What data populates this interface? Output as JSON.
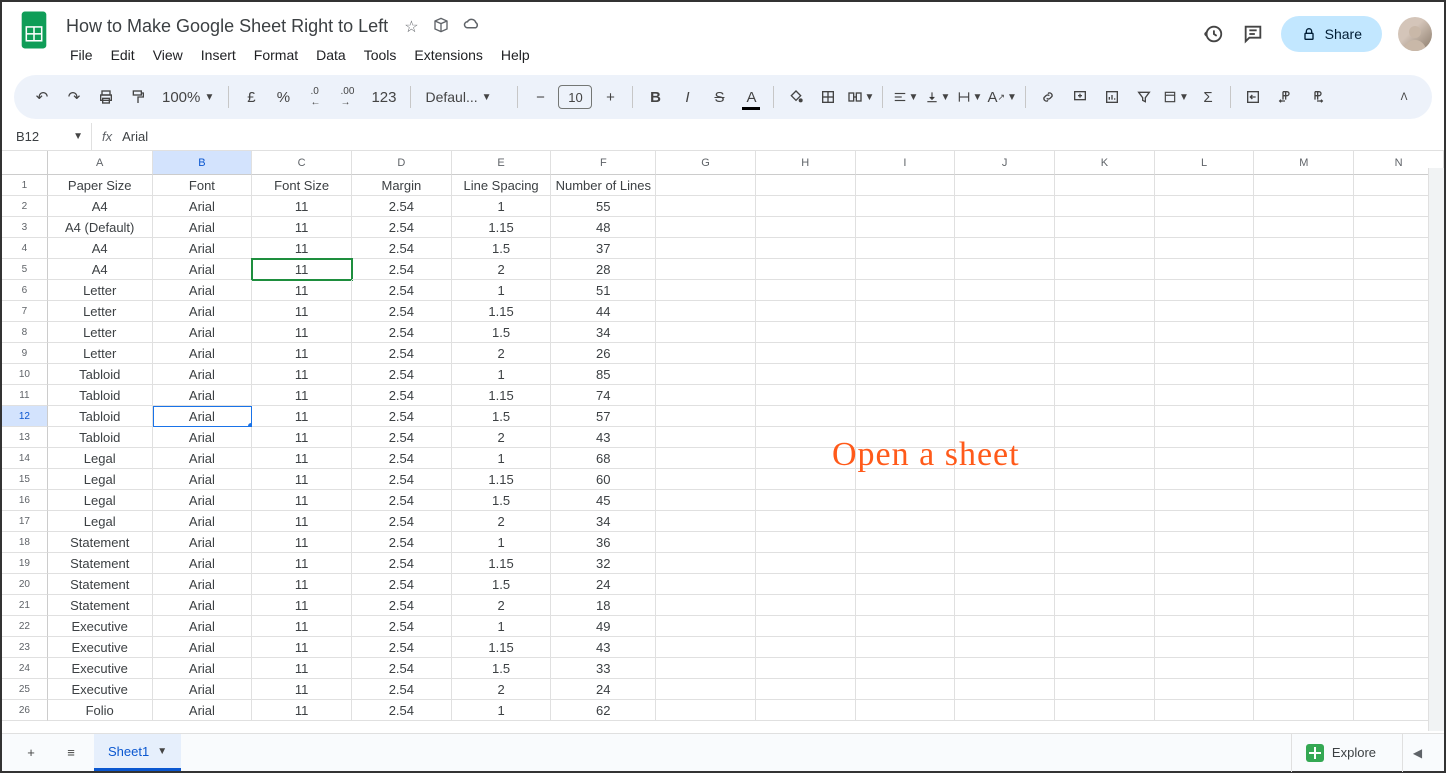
{
  "header": {
    "doc_title": "How to Make Google Sheet Right to Left",
    "menus": [
      "File",
      "Edit",
      "View",
      "Insert",
      "Format",
      "Data",
      "Tools",
      "Extensions",
      "Help"
    ],
    "share_label": "Share"
  },
  "toolbar": {
    "zoom": "100%",
    "currency": "£",
    "percent": "%",
    "dec_dec": ".0",
    "inc_dec": ".00",
    "numfmt": "123",
    "font": "Defaul...",
    "font_size": "10"
  },
  "namebox": "B12",
  "fx_value": "Arial",
  "columns": [
    "A",
    "B",
    "C",
    "D",
    "E",
    "F",
    "G",
    "H",
    "I",
    "J",
    "K",
    "L",
    "M",
    "N"
  ],
  "col_widths": {
    "A": "cA",
    "B": "cB",
    "C": "cC",
    "D": "cD",
    "E": "cE",
    "F": "cF",
    "G": "cG",
    "H": "cH",
    "I": "cI",
    "J": "cJ",
    "K": "cK",
    "L": "cL",
    "M": "cM",
    "N": "cN"
  },
  "selected_col": "B",
  "active_green_cell": {
    "row": 5,
    "col": "C"
  },
  "active_blue_cell": {
    "row": 12,
    "col": "B"
  },
  "rows": [
    {
      "n": 1,
      "cells": {
        "A": "Paper Size",
        "B": "Font",
        "C": "Font Size",
        "D": "Margin",
        "E": "Line Spacing",
        "F": "Number of Lines"
      }
    },
    {
      "n": 2,
      "cells": {
        "A": "A4",
        "B": "Arial",
        "C": "11",
        "D": "2.54",
        "E": "1",
        "F": "55"
      }
    },
    {
      "n": 3,
      "cells": {
        "A": "A4 (Default)",
        "B": "Arial",
        "C": "11",
        "D": "2.54",
        "E": "1.15",
        "F": "48"
      }
    },
    {
      "n": 4,
      "cells": {
        "A": "A4",
        "B": "Arial",
        "C": "11",
        "D": "2.54",
        "E": "1.5",
        "F": "37"
      }
    },
    {
      "n": 5,
      "cells": {
        "A": "A4",
        "B": "Arial",
        "C": "11",
        "D": "2.54",
        "E": "2",
        "F": "28"
      }
    },
    {
      "n": 6,
      "cells": {
        "A": "Letter",
        "B": "Arial",
        "C": "11",
        "D": "2.54",
        "E": "1",
        "F": "51"
      }
    },
    {
      "n": 7,
      "cells": {
        "A": "Letter",
        "B": "Arial",
        "C": "11",
        "D": "2.54",
        "E": "1.15",
        "F": "44"
      }
    },
    {
      "n": 8,
      "cells": {
        "A": "Letter",
        "B": "Arial",
        "C": "11",
        "D": "2.54",
        "E": "1.5",
        "F": "34"
      }
    },
    {
      "n": 9,
      "cells": {
        "A": "Letter",
        "B": "Arial",
        "C": "11",
        "D": "2.54",
        "E": "2",
        "F": "26"
      }
    },
    {
      "n": 10,
      "cells": {
        "A": "Tabloid",
        "B": "Arial",
        "C": "11",
        "D": "2.54",
        "E": "1",
        "F": "85"
      }
    },
    {
      "n": 11,
      "cells": {
        "A": "Tabloid",
        "B": "Arial",
        "C": "11",
        "D": "2.54",
        "E": "1.15",
        "F": "74"
      }
    },
    {
      "n": 12,
      "cells": {
        "A": "Tabloid",
        "B": "Arial",
        "C": "11",
        "D": "2.54",
        "E": "1.5",
        "F": "57"
      }
    },
    {
      "n": 13,
      "cells": {
        "A": "Tabloid",
        "B": "Arial",
        "C": "11",
        "D": "2.54",
        "E": "2",
        "F": "43"
      }
    },
    {
      "n": 14,
      "cells": {
        "A": "Legal",
        "B": "Arial",
        "C": "11",
        "D": "2.54",
        "E": "1",
        "F": "68"
      }
    },
    {
      "n": 15,
      "cells": {
        "A": "Legal",
        "B": "Arial",
        "C": "11",
        "D": "2.54",
        "E": "1.15",
        "F": "60"
      }
    },
    {
      "n": 16,
      "cells": {
        "A": "Legal",
        "B": "Arial",
        "C": "11",
        "D": "2.54",
        "E": "1.5",
        "F": "45"
      }
    },
    {
      "n": 17,
      "cells": {
        "A": "Legal",
        "B": "Arial",
        "C": "11",
        "D": "2.54",
        "E": "2",
        "F": "34"
      }
    },
    {
      "n": 18,
      "cells": {
        "A": "Statement",
        "B": "Arial",
        "C": "11",
        "D": "2.54",
        "E": "1",
        "F": "36"
      }
    },
    {
      "n": 19,
      "cells": {
        "A": "Statement",
        "B": "Arial",
        "C": "11",
        "D": "2.54",
        "E": "1.15",
        "F": "32"
      }
    },
    {
      "n": 20,
      "cells": {
        "A": "Statement",
        "B": "Arial",
        "C": "11",
        "D": "2.54",
        "E": "1.5",
        "F": "24"
      }
    },
    {
      "n": 21,
      "cells": {
        "A": "Statement",
        "B": "Arial",
        "C": "11",
        "D": "2.54",
        "E": "2",
        "F": "18"
      }
    },
    {
      "n": 22,
      "cells": {
        "A": "Executive",
        "B": "Arial",
        "C": "11",
        "D": "2.54",
        "E": "1",
        "F": "49"
      }
    },
    {
      "n": 23,
      "cells": {
        "A": "Executive",
        "B": "Arial",
        "C": "11",
        "D": "2.54",
        "E": "1.15",
        "F": "43"
      }
    },
    {
      "n": 24,
      "cells": {
        "A": "Executive",
        "B": "Arial",
        "C": "11",
        "D": "2.54",
        "E": "1.5",
        "F": "33"
      }
    },
    {
      "n": 25,
      "cells": {
        "A": "Executive",
        "B": "Arial",
        "C": "11",
        "D": "2.54",
        "E": "2",
        "F": "24"
      }
    },
    {
      "n": 26,
      "cells": {
        "A": "Folio",
        "B": "Arial",
        "C": "11",
        "D": "2.54",
        "E": "1",
        "F": "62"
      }
    }
  ],
  "annotation": "Open a sheet",
  "sheet_tab": "Sheet1",
  "explore_label": "Explore"
}
